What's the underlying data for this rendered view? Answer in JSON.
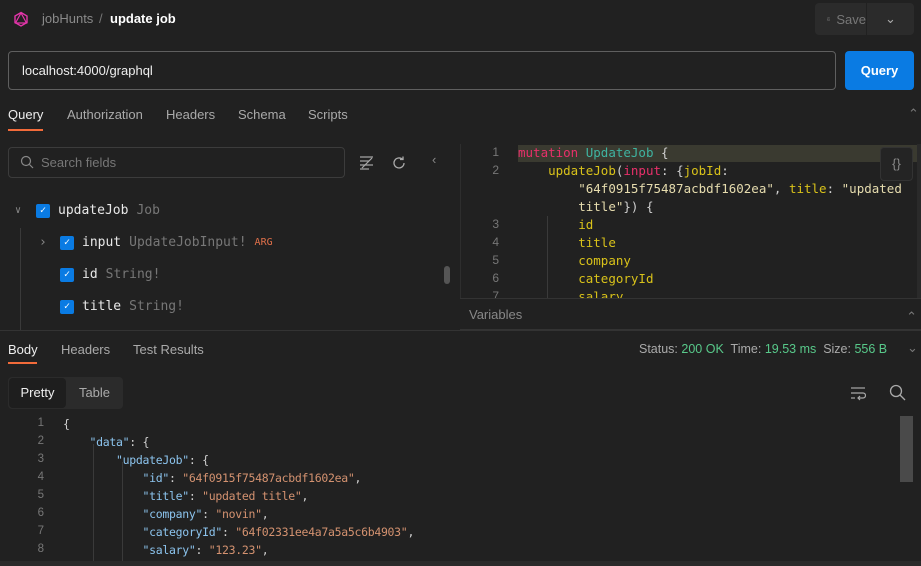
{
  "header": {
    "workspace": "jobHunts",
    "separator": "/",
    "request_name": "update job",
    "save_label": "Save"
  },
  "url": {
    "value": "localhost:4000/graphql",
    "send_label": "Query"
  },
  "request_tabs": [
    {
      "label": "Query",
      "active": true
    },
    {
      "label": "Authorization"
    },
    {
      "label": "Headers"
    },
    {
      "label": "Schema"
    },
    {
      "label": "Scripts"
    }
  ],
  "explorer": {
    "search_placeholder": "Search fields",
    "items": [
      {
        "name": "updateJob",
        "type": "Job",
        "checked": true,
        "expanded": true
      },
      {
        "name": "input",
        "type": "UpdateJobInput!",
        "badge": "ARG",
        "checked": true,
        "expanded": false
      },
      {
        "name": "id",
        "type": "String!",
        "checked": true
      },
      {
        "name": "title",
        "type": "String!",
        "checked": true
      }
    ]
  },
  "query_editor": {
    "lines": [
      {
        "n": "1",
        "tokens": [
          [
            "mutation",
            "kw"
          ],
          [
            " ",
            "p"
          ],
          [
            "UpdateJob",
            "tn"
          ],
          [
            " {",
            "p"
          ]
        ]
      },
      {
        "n": "2",
        "tokens": [
          [
            "    ",
            "p"
          ],
          [
            "updateJob",
            "f"
          ],
          [
            "(",
            "p"
          ],
          [
            "input",
            "kw"
          ],
          [
            ": {",
            "p"
          ],
          [
            "jobId",
            "f"
          ],
          [
            ":",
            "p"
          ]
        ]
      },
      {
        "n": "",
        "tokens": [
          [
            "        ",
            "p"
          ],
          [
            "\"64f0915f75487acbdf1602ea\"",
            "s"
          ],
          [
            ", ",
            "p"
          ],
          [
            "title",
            "f"
          ],
          [
            ": ",
            "p"
          ],
          [
            "\"updated",
            "s"
          ]
        ]
      },
      {
        "n": "",
        "tokens": [
          [
            "        ",
            "p"
          ],
          [
            "title\"",
            "s"
          ],
          [
            "}) {",
            "p"
          ]
        ]
      },
      {
        "n": "3",
        "tokens": [
          [
            "        ",
            "p"
          ],
          [
            "id",
            "f"
          ]
        ]
      },
      {
        "n": "4",
        "tokens": [
          [
            "        ",
            "p"
          ],
          [
            "title",
            "f"
          ]
        ]
      },
      {
        "n": "5",
        "tokens": [
          [
            "        ",
            "p"
          ],
          [
            "company",
            "f"
          ]
        ]
      },
      {
        "n": "6",
        "tokens": [
          [
            "        ",
            "p"
          ],
          [
            "categoryId",
            "f"
          ]
        ]
      },
      {
        "n": "7",
        "tokens": [
          [
            "        ",
            "p"
          ],
          [
            "salary",
            "f"
          ]
        ]
      }
    ]
  },
  "variables_label": "Variables",
  "response_tabs": [
    {
      "label": "Body",
      "active": true
    },
    {
      "label": "Headers"
    },
    {
      "label": "Test Results"
    }
  ],
  "response_meta": {
    "status_label": "Status:",
    "status": "200 OK",
    "time_label": "Time:",
    "time": "19.53 ms",
    "size_label": "Size:",
    "size": "556 B"
  },
  "view_modes": {
    "pretty": "Pretty",
    "table": "Table"
  },
  "response_body": {
    "lines": [
      {
        "n": "1",
        "tokens": [
          [
            "{",
            "p"
          ]
        ]
      },
      {
        "n": "2",
        "tokens": [
          [
            "    ",
            "p"
          ],
          [
            "\"data\"",
            "k"
          ],
          [
            ": {",
            "p"
          ]
        ]
      },
      {
        "n": "3",
        "tokens": [
          [
            "        ",
            "p"
          ],
          [
            "\"updateJob\"",
            "k"
          ],
          [
            ": {",
            "p"
          ]
        ]
      },
      {
        "n": "4",
        "tokens": [
          [
            "            ",
            "p"
          ],
          [
            "\"id\"",
            "k"
          ],
          [
            ": ",
            "p"
          ],
          [
            "\"64f0915f75487acbdf1602ea\"",
            "s"
          ],
          [
            ",",
            "p"
          ]
        ]
      },
      {
        "n": "5",
        "tokens": [
          [
            "            ",
            "p"
          ],
          [
            "\"title\"",
            "k"
          ],
          [
            ": ",
            "p"
          ],
          [
            "\"updated title\"",
            "s"
          ],
          [
            ",",
            "p"
          ]
        ]
      },
      {
        "n": "6",
        "tokens": [
          [
            "            ",
            "p"
          ],
          [
            "\"company\"",
            "k"
          ],
          [
            ": ",
            "p"
          ],
          [
            "\"novin\"",
            "s"
          ],
          [
            ",",
            "p"
          ]
        ]
      },
      {
        "n": "7",
        "tokens": [
          [
            "            ",
            "p"
          ],
          [
            "\"categoryId\"",
            "k"
          ],
          [
            ": ",
            "p"
          ],
          [
            "\"64f02331ee4a7a5a5c6b4903\"",
            "s"
          ],
          [
            ",",
            "p"
          ]
        ]
      },
      {
        "n": "8",
        "tokens": [
          [
            "            ",
            "p"
          ],
          [
            "\"salary\"",
            "k"
          ],
          [
            ": ",
            "p"
          ],
          [
            "\"123.23\"",
            "s"
          ],
          [
            ",",
            "p"
          ]
        ]
      }
    ]
  },
  "colors": {
    "accent": "#0a7be3",
    "tab_underline": "#f26b3a",
    "status_ok": "#58c98a",
    "logo": "#e535ab"
  }
}
